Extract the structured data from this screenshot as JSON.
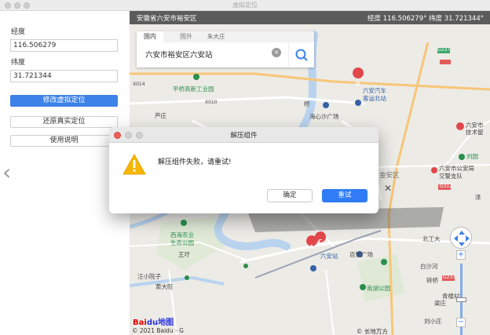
{
  "window": {
    "title": "虚拟定位"
  },
  "left_panel": {
    "longitude_label": "经度",
    "longitude_value": "116.506279",
    "latitude_label": "纬度",
    "latitude_value": "31.721344",
    "modify_button": "修改虚拟定位",
    "restore_button": "还原真实定位",
    "help_button": "使用说明"
  },
  "map": {
    "location": "安徽省六安市裕安区",
    "coordinates": "经度 116.506279°  纬度 31.721344°",
    "search": {
      "tab_domestic": "国内",
      "tab_abroad": "国外",
      "text": "六安市裕安区六安站"
    },
    "labels": {
      "zhudazhuang": "朱大庄",
      "road_g237_top": "G237",
      "x014": "X014",
      "pingqiao": "平桥高新工业园",
      "x010": "X010",
      "luzhuang": "芦庄",
      "qiaoqiao": "桥",
      "liuan_bus_line1": "六安汽车",
      "liuan_bus_line2": "客运北站",
      "haixin": "海心沙广场",
      "liuan_right1": "六安市",
      "liuan_right2": "技术留",
      "xingang": "刘园",
      "jinan": "金安区",
      "police1": "六安市公安局",
      "police2": "交警支队",
      "g312": "G312",
      "xixi1": "西海农业",
      "xixi2": "生态公园",
      "wangzhuang": "王圩",
      "liuan_station": "六安站",
      "baiyue": "百悦广场",
      "beigong": "北工大",
      "yazhuang": "汪小院子",
      "huangdazhuang": "黄大旺",
      "baisha": "白沙河",
      "nanhu": "南湖公园",
      "g237_right": "G237",
      "qinglou": "青楼村",
      "zhuanqiao": "转桥",
      "xiaozhuang": "刘小庄",
      "liangzhuang": "梁庄",
      "ze": "泽"
    },
    "marker_g": "G",
    "marker_a": "A",
    "marker_c": "C",
    "baidu_logo_part1": "Bai",
    "baidu_logo_part2": "du地图",
    "copyright": "© 2021 Baidu - G",
    "copyright_right": "© 长地万方"
  },
  "dialog": {
    "title": "解压组件",
    "message": "解压组件失败，请重试!",
    "cancel_button": "确定",
    "retry_button": "重试"
  },
  "colors": {
    "primary_button": "#3c82e8",
    "dialog_primary": "#2f7cf6",
    "map_header": "#5b5b5b",
    "warning": "#f5b700"
  }
}
